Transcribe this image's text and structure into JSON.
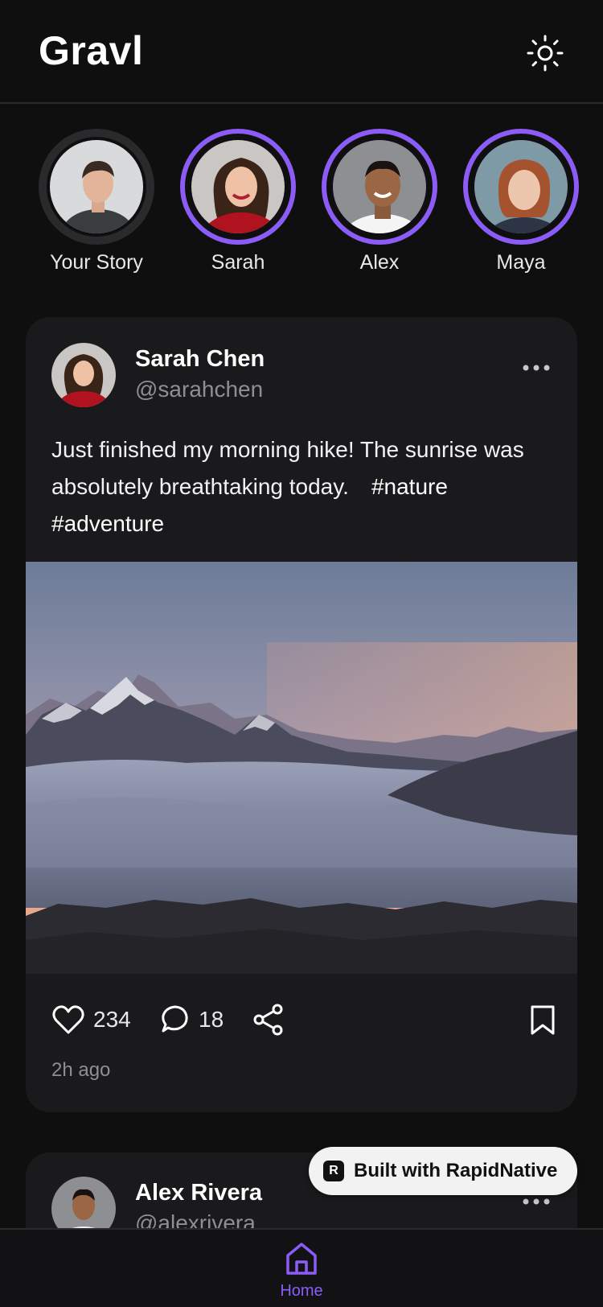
{
  "header": {
    "title": "Gravl",
    "theme_icon": "sun-icon"
  },
  "stories": [
    {
      "name": "Your Story",
      "own": true
    },
    {
      "name": "Sarah",
      "own": false
    },
    {
      "name": "Alex",
      "own": false
    },
    {
      "name": "Maya",
      "own": false
    }
  ],
  "post": {
    "author": "Sarah Chen",
    "handle": "@sarahchen",
    "text_line1": "Just finished my morning hike! The sunrise was",
    "text_line2": "absolutely breathtaking today.",
    "hashtag1": "#nature",
    "hashtag2": "#adventure",
    "likes": "234",
    "comments": "18",
    "time": "2h ago"
  },
  "post2": {
    "author": "Alex Rivera",
    "handle": "@alexrivera"
  },
  "badge": {
    "label": "Built with RapidNative"
  },
  "nav": {
    "home_label": "Home"
  },
  "colors": {
    "accent": "#8b5cf6",
    "background": "#0f0f10",
    "card": "#1a1a1c"
  }
}
